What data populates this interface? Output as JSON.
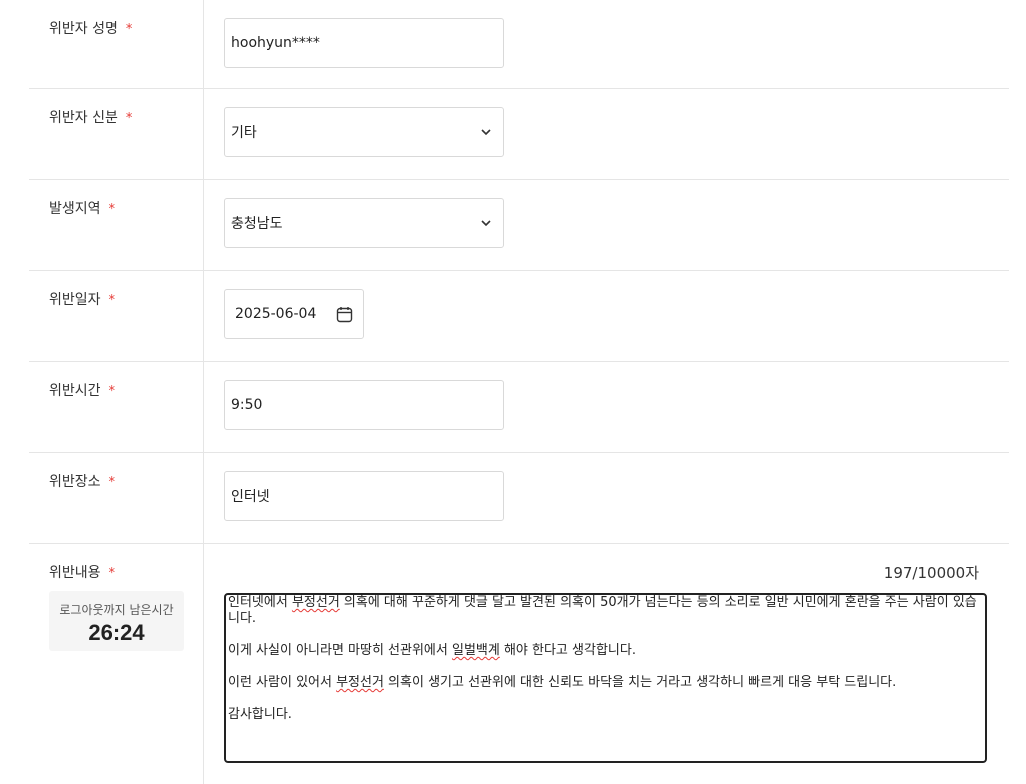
{
  "fields": {
    "violator_name": {
      "label": "위반자 성명",
      "value": "hoohyun****"
    },
    "violator_status": {
      "label": "위반자 신분",
      "value": "기타"
    },
    "region": {
      "label": "발생지역",
      "value": "충청남도"
    },
    "date": {
      "label": "위반일자",
      "value": "2025-06-04"
    },
    "time": {
      "label": "위반시간",
      "value": "9:50"
    },
    "place": {
      "label": "위반장소",
      "value": "인터넷"
    },
    "content": {
      "label": "위반내용",
      "counter": "197/10000자",
      "paragraphs": [
        [
          "인터넷에서 ",
          "부정선거",
          " 의혹에 대해 꾸준하게 댓글 달고 발견된 의혹이 50개가 넘는다는 등의 소리로 일반 시민에게 혼란을 주는 사람이 있습니다."
        ],
        [
          "이게 사실이 아니라면 마땅히 선관위에서 ",
          "일벌백계",
          " 해야 한다고 생각합니다."
        ],
        [
          "이런 사람이 있어서 ",
          "부정선거",
          " 의혹이 생기고 선관위에 대한 신뢰도 바닥을 치는 거라고 생각하니 빠르게 대응 부탁 드립니다."
        ],
        [
          "감사합니다.",
          "",
          ""
        ]
      ]
    }
  },
  "required_mark": "*",
  "timer": {
    "label": "로그아웃까지 남은시간",
    "value": "26:24"
  },
  "icons": {
    "select": "chevron-down-icon",
    "date": "calendar-icon"
  }
}
